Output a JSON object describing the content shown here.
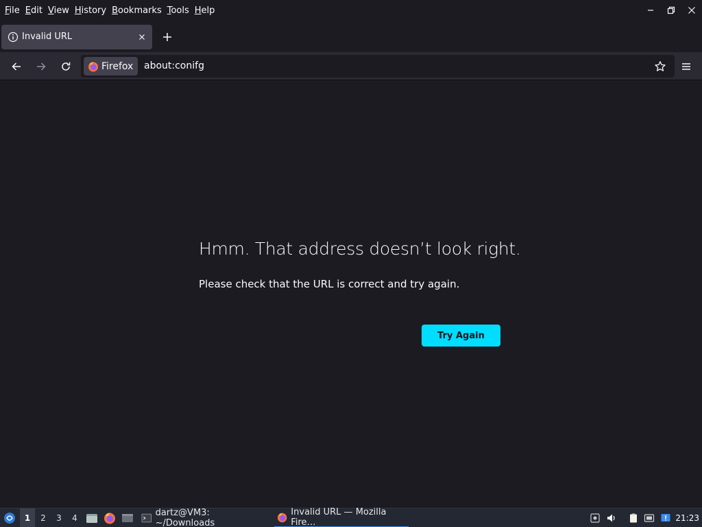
{
  "menubar": {
    "items": [
      {
        "underline": "F",
        "rest": "ile"
      },
      {
        "underline": "E",
        "rest": "dit"
      },
      {
        "underline": "V",
        "rest": "iew"
      },
      {
        "underline": "H",
        "rest": "istory"
      },
      {
        "underline": "B",
        "rest": "ookmarks"
      },
      {
        "underline": "T",
        "rest": "ools"
      },
      {
        "underline": "H",
        "rest": "elp"
      }
    ]
  },
  "tab": {
    "title": "Invalid URL"
  },
  "navbar": {
    "identity_label": "Firefox",
    "url": "about:conifg"
  },
  "error": {
    "title": "Hmm. That address doesn’t look right.",
    "description": "Please check that the URL is correct and try again.",
    "button": "Try Again"
  },
  "taskbar": {
    "workspaces": [
      "1",
      "2",
      "3",
      "4"
    ],
    "active_workspace": "1",
    "tasks": [
      {
        "label": "dartz@VM3: ~/Downloads",
        "icon": "terminal-icon"
      },
      {
        "label": "Invalid URL — Mozilla Fire…",
        "icon": "firefox-icon"
      }
    ],
    "clock": "21:23"
  },
  "colors": {
    "accent": "#00ddff",
    "background": "#1c1b22",
    "toolbar": "#2b2a33"
  }
}
